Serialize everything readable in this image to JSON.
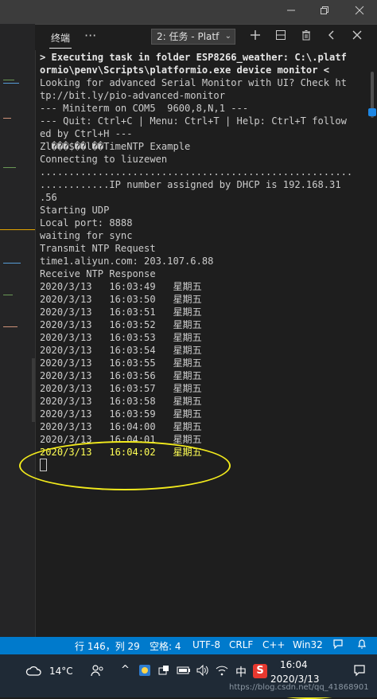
{
  "window": {
    "minimize_icon": "minimize-icon",
    "restore_icon": "restore-icon",
    "close_icon": "close-icon"
  },
  "panel": {
    "tab_label": "终端",
    "more_label": "···",
    "terminal_select": "2: 任务 - Platf",
    "add_icon": "+",
    "split_icon": "split-icon",
    "trash_icon": "trash-icon",
    "prev_icon": "‹",
    "close_icon": "✕"
  },
  "terminal": {
    "lines": [
      "> Executing task in folder ESP8266_weather: C:\\.platf",
      "ormio\\penv\\Scripts\\platformio.exe device monitor <",
      "",
      "Looking for advanced Serial Monitor with UI? Check ht",
      "tp://bit.ly/pio-advanced-monitor",
      "--- Miniterm on COM5  9600,8,N,1 ---",
      "--- Quit: Ctrl+C | Menu: Ctrl+T | Help: Ctrl+T follow",
      "ed by Ctrl+H ---",
      "Zl���$��l��TimeNTP Example",
      "Connecting to liuzewen",
      "......................................................",
      "............IP number assigned by DHCP is 192.168.31",
      ".56",
      "Starting UDP",
      "Local port: 8888",
      "waiting for sync",
      "Transmit NTP Request",
      "time1.aliyun.com: 203.107.6.88",
      "Receive NTP Response",
      "2020/3/13   16:03:49   星期五",
      "2020/3/13   16:03:50   星期五",
      "2020/3/13   16:03:51   星期五",
      "2020/3/13   16:03:52   星期五",
      "2020/3/13   16:03:53   星期五",
      "2020/3/13   16:03:54   星期五",
      "2020/3/13   16:03:55   星期五",
      "2020/3/13   16:03:56   星期五",
      "2020/3/13   16:03:57   星期五",
      "2020/3/13   16:03:58   星期五",
      "2020/3/13   16:03:59   星期五",
      "2020/3/13   16:04:00   星期五",
      "2020/3/13   16:04:01   星期五",
      "2020/3/13   16:04:02   星期五"
    ]
  },
  "statusbar": {
    "cursor_pos": "行 146，列 29",
    "indent": "空格: 4",
    "encoding": "UTF-8",
    "eol": "CRLF",
    "language": "C++",
    "platform": "Win32",
    "feedback_icon": "feedback-icon",
    "bell_icon": "bell-icon"
  },
  "taskbar": {
    "weather_icon": "cloud-icon",
    "temperature": "14°C",
    "people_icon": "people-icon",
    "chevron": "^",
    "ime_lang": "中",
    "sogou_label": "S",
    "time": "16:04",
    "date": "2020/3/13",
    "watermark": "https://blog.csdn.net/qq_41868901",
    "notification_icon": "notification-icon"
  },
  "colors": {
    "statusbar_bg": "#007acc",
    "annotation": "#f2ea1c",
    "terminal_bg": "#1e1e1e"
  }
}
